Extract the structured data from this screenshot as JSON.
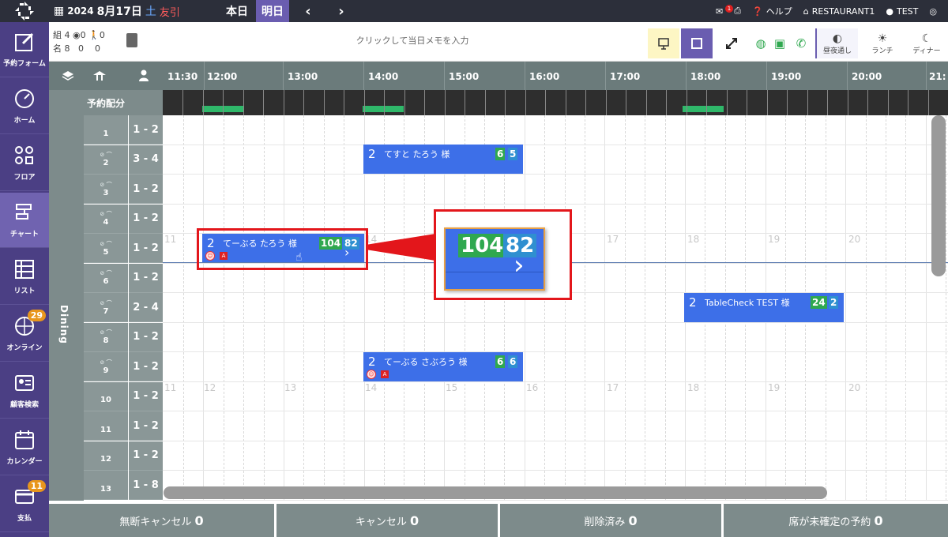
{
  "topbar": {
    "year": "2024",
    "date": "8月17日",
    "dow": "土",
    "rokuyo": "友引",
    "today_label": "本日",
    "tomorrow_label": "明日",
    "help_label": "ヘルプ",
    "restaurant_label": "RESTAURANT1",
    "user_label": "TEST",
    "notif_count": "1"
  },
  "sidebar": {
    "items": [
      {
        "label": "予約フォーム"
      },
      {
        "label": "ホーム"
      },
      {
        "label": "フロア"
      },
      {
        "label": "チャート"
      },
      {
        "label": "リスト"
      },
      {
        "label": "オンライン",
        "badge": "29"
      },
      {
        "label": "顧客検索"
      },
      {
        "label": "カレンダー"
      },
      {
        "label": "支払",
        "badge": "11"
      }
    ]
  },
  "counts": {
    "row1_a": "組 4",
    "row1_b": "0",
    "row1_c": "0",
    "row2_a": "名 8",
    "row2_b": "0",
    "row2_c": "0"
  },
  "memo_placeholder": "クリックして当日メモを入力",
  "modes": [
    {
      "label": "昼夜通し"
    },
    {
      "label": "ランチ"
    },
    {
      "label": "ディナー"
    }
  ],
  "timeline": {
    "hours": [
      "11:30",
      "12:00",
      "13:00",
      "14:00",
      "15:00",
      "16:00",
      "17:00",
      "18:00",
      "19:00",
      "20:00",
      "21:"
    ],
    "alloc_label": "予約配分",
    "area": "Dining",
    "faint_hours_a": [
      "11",
      "12",
      "13",
      "14",
      "15",
      "16",
      "17",
      "18",
      "19",
      "20"
    ],
    "faint_hours_b": [
      "11",
      "12",
      "13",
      "14",
      "15",
      "16",
      "17",
      "18",
      "19",
      "20"
    ],
    "faint_hours_top": [
      "11",
      "14",
      "17",
      "18",
      "19",
      "20"
    ]
  },
  "tables": [
    {
      "num": "1",
      "cap": "1 - 2"
    },
    {
      "num": "2",
      "cap": "3 - 4"
    },
    {
      "num": "3",
      "cap": "1 - 2"
    },
    {
      "num": "4",
      "cap": "1 - 2"
    },
    {
      "num": "5",
      "cap": "1 - 2"
    },
    {
      "num": "6",
      "cap": "1 - 2"
    },
    {
      "num": "7",
      "cap": "2 - 4"
    },
    {
      "num": "8",
      "cap": "1 - 2"
    },
    {
      "num": "9",
      "cap": "1 - 2"
    },
    {
      "num": "10",
      "cap": "1 - 2"
    },
    {
      "num": "11",
      "cap": "1 - 2"
    },
    {
      "num": "12",
      "cap": "1 - 2"
    },
    {
      "num": "13",
      "cap": "1 - 8"
    }
  ],
  "reservations": [
    {
      "size": "2",
      "name": "てすと たろう 様",
      "b1": "6",
      "b2": "5"
    },
    {
      "size": "2",
      "name": "てーぶる たろう 様",
      "b1": "104",
      "b2": "82"
    },
    {
      "size": "2",
      "name": "TableCheck TEST 様",
      "b1": "24",
      "b2": "2"
    },
    {
      "size": "2",
      "name": "てーぶる さぶろう 様",
      "b1": "6",
      "b2": "6"
    }
  ],
  "zoom": {
    "b1": "104",
    "b2": "82"
  },
  "footer": [
    {
      "label": "無断キャンセル",
      "count": "0"
    },
    {
      "label": "キャンセル",
      "count": "0"
    },
    {
      "label": "削除済み",
      "count": "0"
    },
    {
      "label": "席が未確定の予約",
      "count": "0"
    }
  ]
}
